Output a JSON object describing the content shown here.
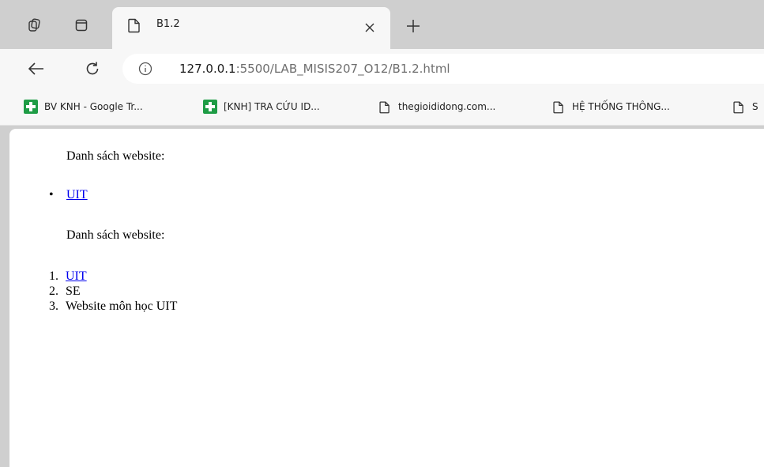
{
  "tabstrip": {
    "workspaces_icon": "workspaces-icon",
    "tab_actions_icon": "tab-actions-icon",
    "active_tab": {
      "title": "B1.2",
      "icon": "page-icon",
      "close_icon": "close-icon"
    },
    "new_tab_icon": "plus-icon"
  },
  "toolbar": {
    "back_icon": "back-arrow-icon",
    "reload_icon": "reload-icon",
    "info_icon": "info-icon",
    "url_host": "127.0.0.1",
    "url_rest": ":5500/LAB_MISIS207_O12/B1.2.html"
  },
  "bookmarks": [
    {
      "label": "BV KNH - Google Tr...",
      "icon": "sheets-icon"
    },
    {
      "label": "[KNH] TRA CỨU ID...",
      "icon": "sheets-icon"
    },
    {
      "label": "thegioididong.com...",
      "icon": "page-icon"
    },
    {
      "label": "HỆ THỐNG THÔNG...",
      "icon": "page-icon"
    },
    {
      "label": "S",
      "icon": "page-icon"
    }
  ],
  "page": {
    "heading1": "Danh sách website:",
    "unordered_list": [
      {
        "bullet": "•",
        "text": "UIT",
        "is_link": true
      }
    ],
    "heading2": "Danh sách website:",
    "ordered_list": [
      {
        "num": "1.",
        "text": "UIT",
        "is_link": true
      },
      {
        "num": "2.",
        "text": "SE",
        "is_link": false
      },
      {
        "num": "3.",
        "text": "Website môn học UIT",
        "is_link": false
      }
    ]
  }
}
